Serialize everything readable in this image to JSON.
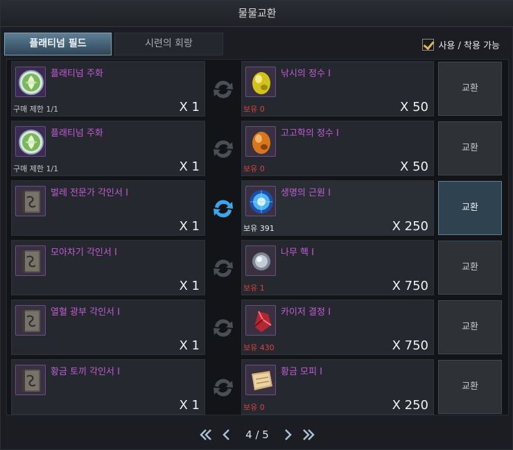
{
  "window": {
    "title": "물물교환"
  },
  "tabs": [
    {
      "label": "플래티넘 필드",
      "active": true
    },
    {
      "label": "시련의 회랑",
      "active": false
    }
  ],
  "filter": {
    "label": "사용 / 착용 가능",
    "checked": true
  },
  "exchange_button_label": "교환",
  "rows": [
    {
      "give": {
        "name": "플래티넘 주화",
        "icon": "platinum-coin-icon",
        "sub": "구매 제한 1/1",
        "qty": "X 1"
      },
      "get": {
        "name": "낚시의 정수 I",
        "icon": "fishing-essence-icon",
        "sub": "보유 0",
        "qty": "X 50"
      },
      "highlight": false
    },
    {
      "give": {
        "name": "플래티넘 주화",
        "icon": "platinum-coin-icon",
        "sub": "구매 제한 1/1",
        "qty": "X 1"
      },
      "get": {
        "name": "고고학의 정수 I",
        "icon": "archaeology-essence-icon",
        "sub": "보유 0",
        "qty": "X 50"
      },
      "highlight": false
    },
    {
      "give": {
        "name": "벌레 전문가 각인서 I",
        "icon": "engraving-book-icon",
        "sub": "",
        "qty": "X 1"
      },
      "get": {
        "name": "생명의 근원 I",
        "icon": "life-origin-orb-icon",
        "sub": "보유 391",
        "qty": "X 250"
      },
      "highlight": true
    },
    {
      "give": {
        "name": "모아차기 각인서 I",
        "icon": "engraving-book-icon",
        "sub": "",
        "qty": "X 1"
      },
      "get": {
        "name": "나무 핵 I",
        "icon": "wood-core-icon",
        "sub": "보유 1",
        "qty": "X 750"
      },
      "highlight": false
    },
    {
      "give": {
        "name": "열혈 광부 각인서 I",
        "icon": "engraving-book-icon",
        "sub": "",
        "qty": "X 1"
      },
      "get": {
        "name": "카이저 결정 I",
        "icon": "kaiser-crystal-icon",
        "sub": "보유 430",
        "qty": "X 750"
      },
      "highlight": false
    },
    {
      "give": {
        "name": "황금 토끼 각인서 I",
        "icon": "engraving-book-icon",
        "sub": "",
        "qty": "X 1"
      },
      "get": {
        "name": "황금 모피 I",
        "icon": "golden-fur-icon",
        "sub": "보유 0",
        "qty": "X 250"
      },
      "highlight": false
    }
  ],
  "pagination": {
    "current": 4,
    "total": 5,
    "label": "4 / 5"
  },
  "colors": {
    "item_name": "#c25cd6",
    "owned_zero": "#e04040",
    "accent_blue": "#3aa7ea"
  }
}
